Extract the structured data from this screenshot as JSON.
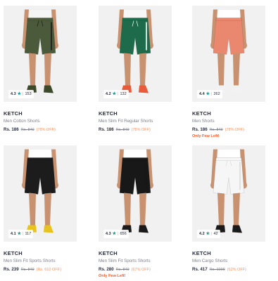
{
  "products": [
    {
      "rating": "4.3",
      "count": "153",
      "brand": "KETCH",
      "title": "Men Cotton Shorts",
      "price": "Rs. 186",
      "mrp": "Rs. 849",
      "discount": "(78% OFF)",
      "stock": "",
      "short_color": "#4b5a3a",
      "shirt_color": "#f5f5f5",
      "accent": "#1a1a1a",
      "shoe_color": "#3d4a2a",
      "skin": "#c89270"
    },
    {
      "rating": "4.2",
      "count": "132",
      "brand": "KETCH",
      "title": "Men Slim Fit Regular Shorts",
      "price": "Rs. 186",
      "mrp": "Rs. 849",
      "discount": "(78% OFF)",
      "stock": "",
      "short_color": "#1d6b4b",
      "shirt_color": "#f7f7f7",
      "accent": "#ffffff",
      "shoe_color": "#e85a3a",
      "skin": "#c89270"
    },
    {
      "rating": "4.4",
      "count": "262",
      "brand": "KETCH",
      "title": "Men Shorts",
      "price": "Rs. 186",
      "mrp": "Rs. 849",
      "discount": "(78% OFF)",
      "stock": "Only Few Left!",
      "short_color": "#e9876f",
      "shirt_color": "#ffffff",
      "accent": "#e9876f",
      "shoe_color": "#f2f2f2",
      "skin": "#c89270"
    },
    {
      "rating": "4.1",
      "count": "117",
      "brand": "KETCH",
      "title": "Men Slim Fit Sports Shorts",
      "price": "Rs. 239",
      "mrp": "Rs. 849",
      "discount": "(Rs. 610 OFF)",
      "stock": "",
      "short_color": "#1c1c1c",
      "shirt_color": "#ffffff",
      "accent": "#1c1c1c",
      "shoe_color": "#e8c21d",
      "skin": "#c89270"
    },
    {
      "rating": "4.3",
      "count": "656",
      "brand": "KETCH",
      "title": "Men Slim Fit Sports Shorts",
      "price": "Rs. 280",
      "mrp": "Rs. 849",
      "discount": "(67% OFF)",
      "stock": "Only Few Left!",
      "short_color": "#181818",
      "shirt_color": "#ffffff",
      "accent": "#181818",
      "shoe_color": "#1a1a1a",
      "skin": "#c89270"
    },
    {
      "rating": "4.2",
      "count": "42",
      "brand": "KETCH",
      "title": "Men Cargo Shorts",
      "price": "Rs. 417",
      "mrp": "Rs. 1099",
      "discount": "(62% OFF)",
      "stock": "",
      "short_color": "#f6f6f6",
      "shirt_color": "#ffffff",
      "accent": "#dcdcdc",
      "shoe_color": "#1a1a1a",
      "skin": "#c89270"
    }
  ]
}
